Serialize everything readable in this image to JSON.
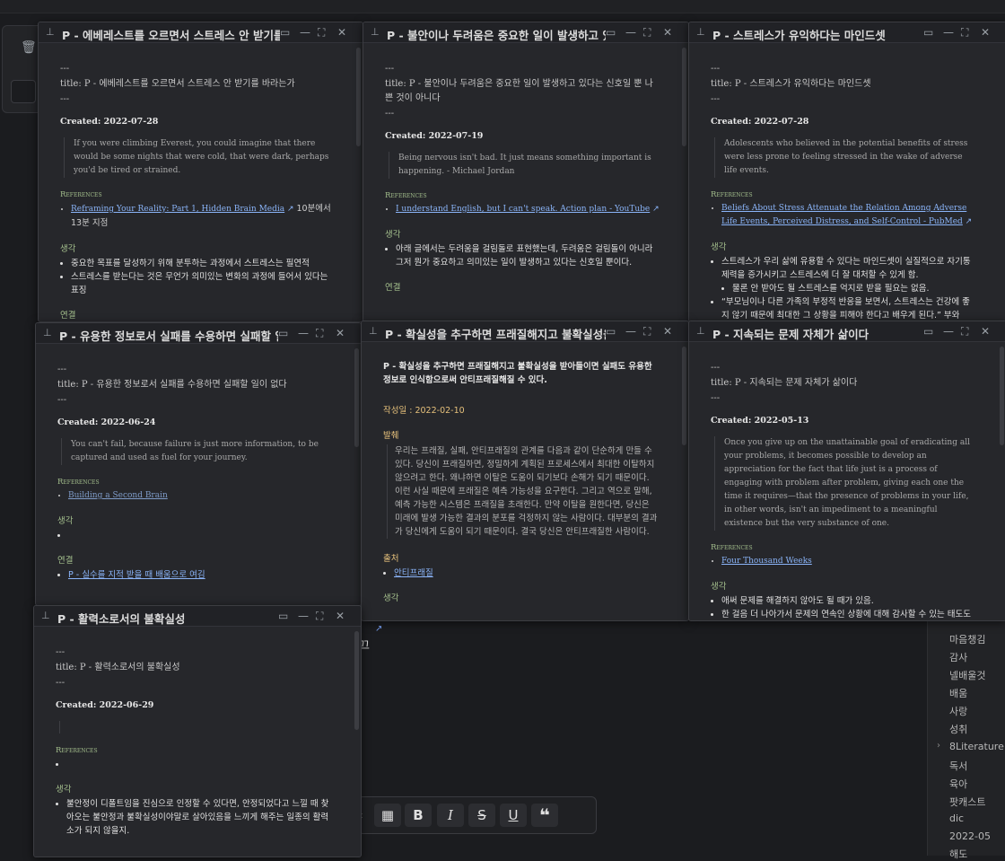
{
  "background": {
    "sidebar_items": [
      "마음챙김",
      "감사",
      "넬배울것",
      "배움",
      "사랑",
      "성취",
      "8Literature",
      "독서",
      "육아",
      "팟캐스트",
      "dic",
      "2022-05",
      "해도"
    ],
    "trash_icon": "trash-icon",
    "text_fragment": "끄",
    "toolbar_buttons": [
      "calendar-icon",
      "bold-icon",
      "italic-icon",
      "strikethrough-icon",
      "underline-icon",
      "quote-icon"
    ]
  },
  "windows": [
    {
      "title": "P - 에베레스트를 오르면서 스트레스 안 받기를 바라는가",
      "fm_title": "title: P - 에베레스트를 오르면서 스트레스 안 받기를 바라는가",
      "created": "Created: 2022-07-28",
      "quote": "If you were climbing Everest, you could imagine that there would be some nights that were cold, that were dark, perhaps you'd be tired or strained.",
      "references_label": "References",
      "ref_link": "Reframing Your Reality: Part 1, Hidden Brain Media",
      "ref_suffix": "10분에서 13분 지점",
      "thoughts_label": "생각",
      "thoughts": [
        "중요한 목표를 달성하기 위해 분투하는 과정에서 스트레스는 필연적",
        "스트레스를 받는다는 것은 무언가 의미있는 변화의 과정에 들어서 있다는 표징"
      ],
      "more_label": "연결"
    },
    {
      "title": "P - 불안이나 두려움은 중요한 일이 발생하고 있다는 신호일 뿐 나쁜 것이 아니다",
      "fm_title": "title: P - 불안이나 두려움은 중요한 일이 발생하고 있다는 신호일 뿐 나쁜 것이 아니다",
      "created": "Created: 2022-07-19",
      "quote": "Being nervous isn't bad. It just means something important is happening. - Michael Jordan",
      "references_label": "References",
      "ref_link": "I understand English, but I can't speak. Action plan - YouTube",
      "thoughts_label": "생각",
      "thoughts": [
        "아래 글에서는 두려움을 걸림돌로 표현했는데, 두려움은 걸림돌이 아니라 그저 뭔가 중요하고 의미있는 일이 발생하고 있다는 신호일 뿐이다."
      ],
      "more_label": "연결"
    },
    {
      "title": "P - 스트레스가 유익하다는 마인드셋",
      "fm_title": "title: P - 스트레스가 유익하다는 마인드셋",
      "created": "Created: 2022-07-28",
      "quote": "Adolescents who believed in the potential benefits of stress were less prone to feeling stressed in the wake of adverse life events.",
      "references_label": "References",
      "ref_link": "Beliefs About Stress Attenuate the Relation Among Adverse Life Events, Perceived Distress, and Self-Control - PubMed",
      "thoughts_label": "생각",
      "thoughts": [
        "스트레스가 우리 삶에 유용할 수 있다는 마인드셋이 실질적으로 자기통제력을 증가시키고 스트레스에 더 잘 대처할 수 있게 함.",
        "물론 안 받아도 될 스트레스를 억지로 받을 필요는 없음.",
        "“부모님이나 다른 가족의 부정적 반응을 보면서, 스트레스는 건강에 좋지 않기 때문에 최대한 그 상황을 피해야 한다고 배우게 된다.” 부와"
      ]
    },
    {
      "title": "P - 유용한 정보로서 실패를 수용하면 실패할 일이 없다",
      "fm_title": "title: P - 유용한 정보로서 실패를 수용하면 실패할 일이 없다",
      "created": "Created: 2022-06-24",
      "quote": "You can't fail, because failure is just more information, to be captured and used as fuel for your journey.",
      "references_label": "References",
      "ref_link": "Building a Second Brain",
      "thoughts_label": "생각",
      "more_label": "연결",
      "more_link": "P - 실수를 지적 받을 때 배움으로 여김"
    },
    {
      "title": "P - 확실성을 추구하면 프래질해지고 불확실성을 받아들이면 실패도 유용한 정보로 인식함으로써 안티프래질해질 수 있다",
      "summary": "P - 확실성을 추구하면 프래질해지고 불확실성을 받아들이면 실패도 유용한 정보로 인식함으로써 안티프래질해질 수 있다.",
      "created_label": "작성일 : 2022-02-10",
      "excerpt_label": "발췌",
      "excerpt": "우리는 프래질, 실패, 안티프래질의 관계를 다음과 같이 단순하게 만들 수 있다. 당신이 프래질하면, 정밀하게 계획된 프로세스에서 최대한 이탈하지 않으려고 한다. 왜냐하면 이탈은 도움이 되기보다 손해가 되기 때문이다. 이런 사실 때문에 프래질은 예측 가능성을 요구한다. 그리고 역으로 말해, 예측 가능한 시스템은 프래질을 초래한다. 만약 이탈을 원한다면, 당신은 미래에 발생 가능한 결과의 분포를 걱정하지 않는 사람이다. 대부분의 결과가 당신에게 도움이 되기 때문이다. 결국 당신은 안티프래질한 사람이다.",
      "source_label": "출처",
      "source_link": "안티프래질",
      "thoughts_label": "생각"
    },
    {
      "title": "P - 지속되는 문제 자체가 삶이다",
      "fm_title": "title: P - 지속되는 문제 자체가 삶이다",
      "created": "Created: 2022-05-13",
      "quote": "Once you give up on the unattainable goal of eradicating all your problems, it becomes possible to develop an appreciation for the fact that life just is a process of engaging with problem after problem, giving each one the time it requires—that the presence of problems in your life, in other words, isn't an impediment to a meaningful existence but the very substance of one.",
      "references_label": "References",
      "ref_link": "Four Thousand Weeks",
      "thoughts_label": "생각",
      "thoughts": [
        "애써 문제를 해결하지 않아도 될 때가 있음.",
        "한 걸음 더 나아가서 문제의 연속인 상황에 대해 감사할 수 있는 태도도 불가능한 것만은 아님"
      ]
    },
    {
      "title": "P - 활력소로서의 불확실성",
      "fm_title": "title: P - 활력소로서의 불확실성",
      "created": "Created: 2022-06-29",
      "references_label": "References",
      "thoughts_label": "생각",
      "thoughts": [
        "불안정이 디폴트임을 진심으로 인정할 수 있다면, 안정되었다고 느낄 때 찾아오는 불안정과 불확실성이야말로 살아있음을 느끼게 해주는 일종의 활력소가 되지 않을지."
      ]
    }
  ]
}
